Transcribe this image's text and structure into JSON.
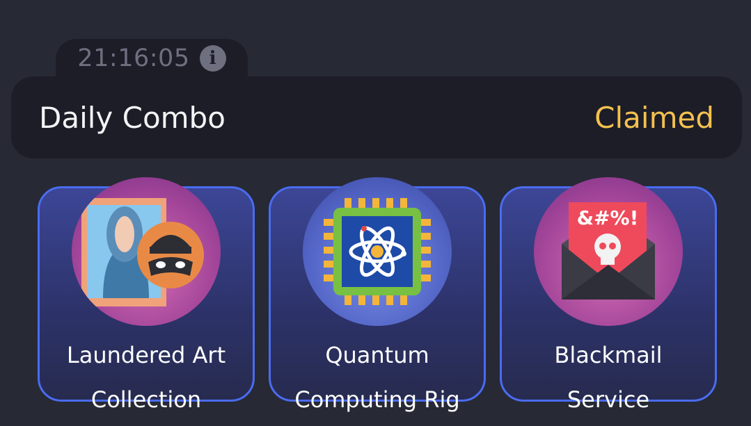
{
  "timer": {
    "time": "21:16:05",
    "icon": "info-icon"
  },
  "combo": {
    "title": "Daily Combo",
    "status": "Claimed",
    "status_color": "#f4c14f"
  },
  "cards": [
    {
      "label_line1": "Laundered Art",
      "label_line2": "Collection",
      "icon": "art-thief-icon"
    },
    {
      "label_line1": "Quantum",
      "label_line2": "Computing Rig",
      "icon": "quantum-chip-icon"
    },
    {
      "label_line1": "Blackmail",
      "label_line2": "Service",
      "icon": "blackmail-letter-icon",
      "letter_text": "&#%!"
    }
  ],
  "colors": {
    "background": "#272935",
    "panel": "#1c1d27",
    "card_border": "#4a6cf0"
  }
}
